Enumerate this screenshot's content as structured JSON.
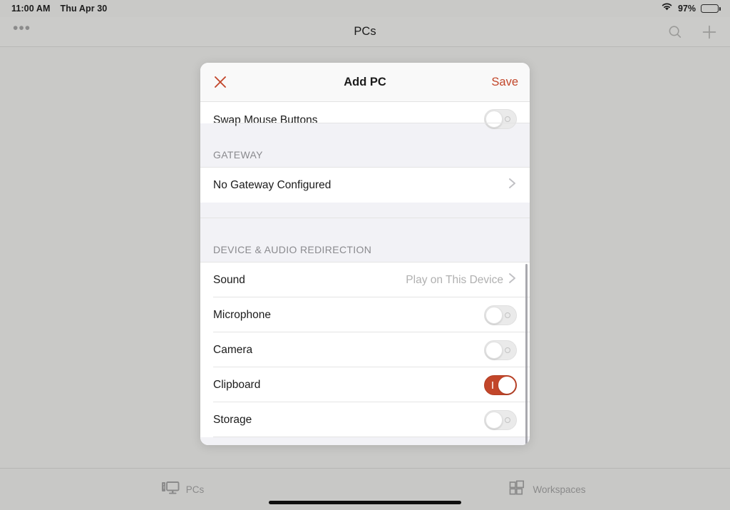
{
  "status_bar": {
    "time": "11:00 AM",
    "date": "Thu Apr 30",
    "wifi_icon": "wifi-icon",
    "battery_percent": "97%",
    "battery_icon": "battery-icon"
  },
  "nav_bar": {
    "more_label": "•••",
    "title": "PCs",
    "search_icon": "search-icon",
    "add_icon": "plus-icon"
  },
  "modal": {
    "close_icon": "close-icon",
    "title": "Add PC",
    "save_label": "Save",
    "accent_color": "#c2462a",
    "rows_top": [
      {
        "label": "Swap Mouse Buttons",
        "type": "toggle",
        "value": "off"
      }
    ],
    "sections": [
      {
        "header": "GATEWAY",
        "rows": [
          {
            "label": "No Gateway Configured",
            "type": "disclosure",
            "value": "",
            "chevron_icon": "chevron-right-icon"
          }
        ]
      },
      {
        "header": "DEVICE & AUDIO REDIRECTION",
        "rows": [
          {
            "label": "Sound",
            "type": "disclosure",
            "value": "Play on This Device",
            "chevron_icon": "chevron-right-icon"
          },
          {
            "label": "Microphone",
            "type": "toggle",
            "value": "off"
          },
          {
            "label": "Camera",
            "type": "toggle",
            "value": "off"
          },
          {
            "label": "Clipboard",
            "type": "toggle",
            "value": "on"
          },
          {
            "label": "Storage",
            "type": "toggle",
            "value": "off"
          }
        ]
      }
    ]
  },
  "tab_bar": {
    "tabs": [
      {
        "label": "PCs",
        "icon": "desktop-computer-icon",
        "selected": true
      },
      {
        "label": "Workspaces",
        "icon": "grid-squares-icon",
        "selected": false
      }
    ]
  }
}
